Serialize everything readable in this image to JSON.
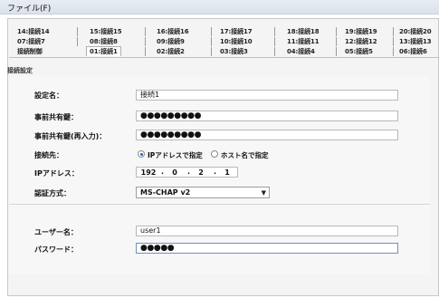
{
  "menubar": {
    "file_menu": "ファイル(F)"
  },
  "tabs": {
    "row1": [
      "14:接続14",
      "15:接続15",
      "16:接続16",
      "17:接続17",
      "18:接続18",
      "19:接続19",
      "20:接続20"
    ],
    "row2": [
      "07:接続7",
      "08:接続8",
      "09:接続9",
      "10:接続10",
      "11:接続11",
      "12:接続12",
      "13:接続13"
    ],
    "row3": [
      "接続制御",
      "01:接続1",
      "02:接続2",
      "03:接続3",
      "04:接続4",
      "05:接続5",
      "06:接続6"
    ],
    "active": "01:接続1"
  },
  "section": {
    "title": "接続設定"
  },
  "form": {
    "setting_name_label": "設定名：",
    "setting_name_value": "接続1",
    "psk_label": "事前共有鍵：",
    "psk_value": "●●●●●●●●●",
    "psk_confirm_label": "事前共有鍵(再入力)：",
    "psk_confirm_value": "●●●●●●●●●",
    "destination_label": "接続先：",
    "radio_ip_label": "IPアドレスで指定",
    "radio_host_label": "ホスト名で指定",
    "radio_selected": "ip",
    "ip_label": "IPアドレス：",
    "ip_octets": [
      "192",
      "0",
      "2",
      "1"
    ],
    "auth_label": "認証方式：",
    "auth_value": "MS-CHAP v2",
    "username_label": "ユーザー名：",
    "username_value": "user1",
    "password_label": "パスワード：",
    "password_value": "●●●●●"
  }
}
